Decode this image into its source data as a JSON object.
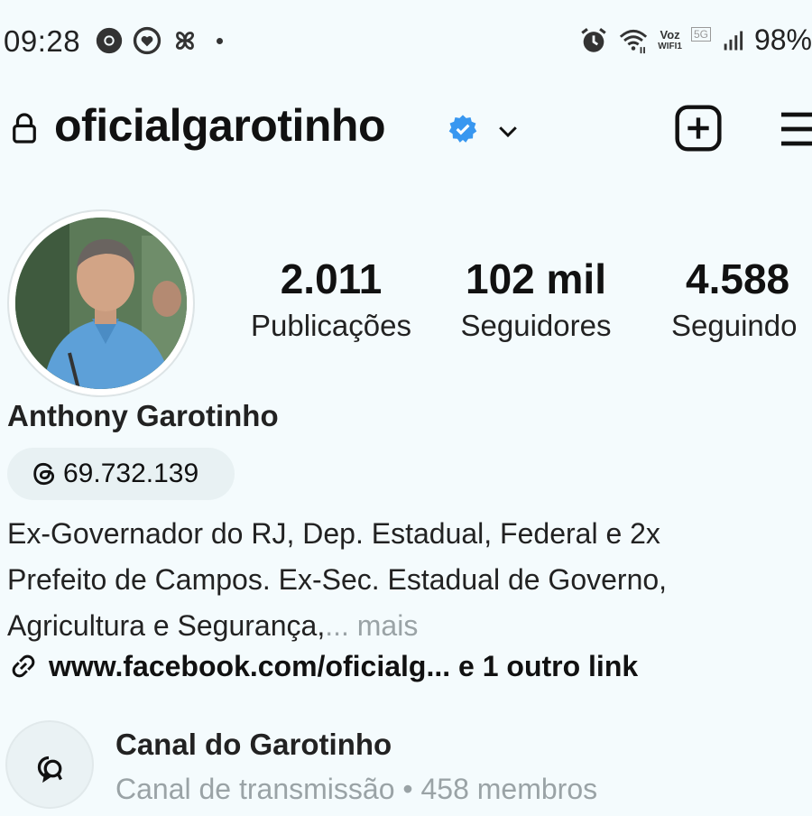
{
  "status_bar": {
    "time": "09:28",
    "network_label": "Voz",
    "wifi_label": "WIFI1",
    "generation": "5G",
    "battery": "98%"
  },
  "header": {
    "username": "oficialgarotinho",
    "icons": [
      "lock-icon",
      "verified-badge-icon",
      "chevron-down-icon",
      "create-post-icon",
      "menu-icon"
    ],
    "verified_color": "#3897f0"
  },
  "profile": {
    "stats": [
      {
        "value": "2.011",
        "label": "Publicações"
      },
      {
        "value": "102 mil",
        "label": "Seguidores"
      },
      {
        "value": "4.588",
        "label": "Seguindo"
      }
    ],
    "full_name": "Anthony Garotinho",
    "threads_count": "69.732.139",
    "bio_lines": [
      "Ex-Governador do RJ, Dep. Estadual, Federal e 2x",
      "Prefeito de Campos. Ex-Sec. Estadual de Governo,",
      "Agricultura e Segurança,"
    ],
    "bio_more": "... mais",
    "link_text": "www.facebook.com/oficialg... e 1 outro link"
  },
  "channel": {
    "name": "Canal do Garotinho",
    "subtitle": "Canal de transmissão • 458 membros"
  }
}
